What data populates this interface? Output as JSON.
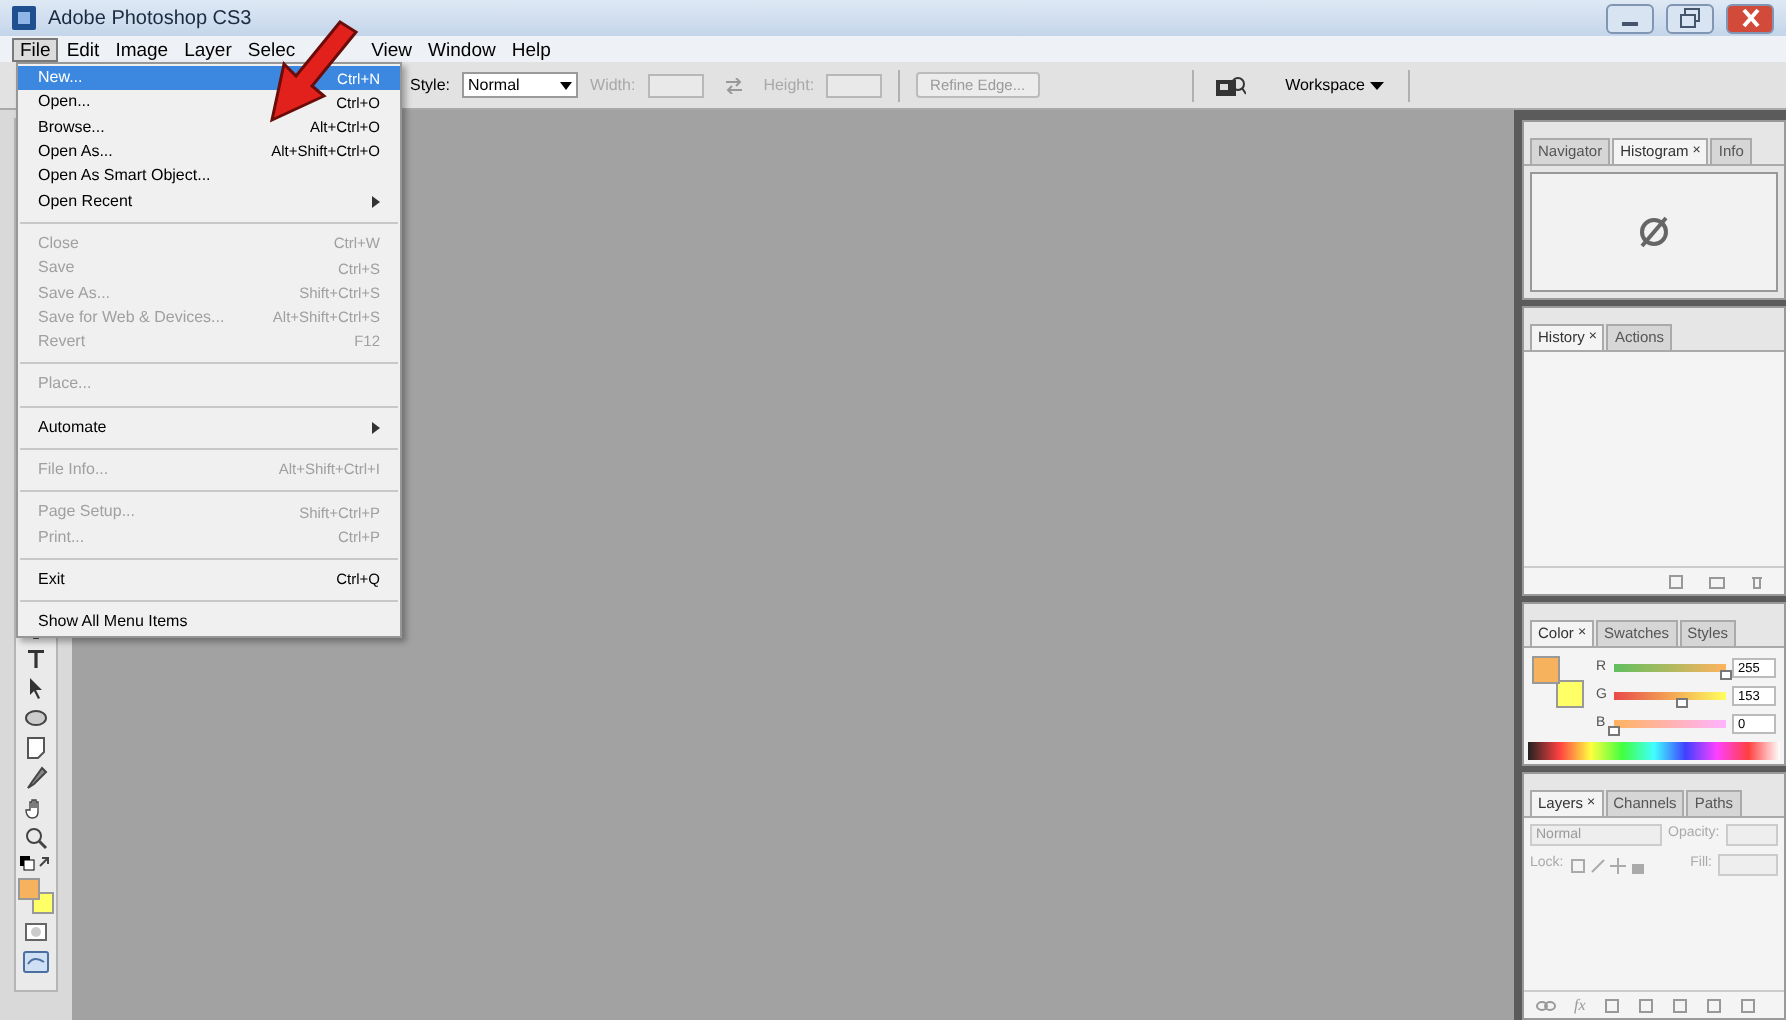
{
  "window": {
    "title": "Adobe Photoshop CS3"
  },
  "menu_bar": [
    {
      "label": "File",
      "selected": true
    },
    {
      "label": "Edit",
      "selected": false
    },
    {
      "label": "Image",
      "selected": false
    },
    {
      "label": "Layer",
      "selected": false
    },
    {
      "label": "Selec",
      "selected": false
    },
    {
      "label": "View",
      "selected": false
    },
    {
      "label": "Window",
      "selected": false
    },
    {
      "label": "Help",
      "selected": false
    }
  ],
  "file_menu": [
    {
      "kind": "item",
      "label": "New...",
      "shortcut": "Ctrl+N",
      "disabled": false,
      "selected": true
    },
    {
      "kind": "item",
      "label": "Open...",
      "shortcut": "Ctrl+O",
      "disabled": false,
      "selected": false
    },
    {
      "kind": "item",
      "label": "Browse...",
      "shortcut": "Alt+Ctrl+O",
      "disabled": false,
      "selected": false
    },
    {
      "kind": "item",
      "label": "Open As...",
      "shortcut": "Alt+Shift+Ctrl+O",
      "disabled": false,
      "selected": false
    },
    {
      "kind": "item",
      "label": "Open As Smart Object...",
      "disabled": false,
      "selected": false
    },
    {
      "kind": "submenu",
      "label": "Open Recent",
      "disabled": false,
      "selected": false
    },
    {
      "kind": "separator"
    },
    {
      "kind": "item",
      "label": "Close",
      "shortcut": "Ctrl+W",
      "disabled": true,
      "selected": false
    },
    {
      "kind": "item",
      "label": "Save",
      "shortcut": "Ctrl+S",
      "disabled": true,
      "selected": false
    },
    {
      "kind": "item",
      "label": "Save As...",
      "shortcut": "Shift+Ctrl+S",
      "disabled": true,
      "selected": false
    },
    {
      "kind": "item",
      "label": "Save for Web & Devices...",
      "shortcut": "Alt+Shift+Ctrl+S",
      "disabled": true,
      "selected": false
    },
    {
      "kind": "item",
      "label": "Revert",
      "shortcut": "F12",
      "disabled": true,
      "selected": false
    },
    {
      "kind": "separator"
    },
    {
      "kind": "item",
      "label": "Place...",
      "disabled": true,
      "selected": false
    },
    {
      "kind": "separator"
    },
    {
      "kind": "submenu",
      "label": "Automate",
      "disabled": false,
      "selected": false
    },
    {
      "kind": "separator"
    },
    {
      "kind": "item",
      "label": "File Info...",
      "shortcut": "Alt+Shift+Ctrl+I",
      "disabled": true,
      "selected": false
    },
    {
      "kind": "separator"
    },
    {
      "kind": "item",
      "label": "Page Setup...",
      "shortcut": "Shift+Ctrl+P",
      "disabled": true,
      "selected": false
    },
    {
      "kind": "item",
      "label": "Print...",
      "shortcut": "Ctrl+P",
      "disabled": true,
      "selected": false
    },
    {
      "kind": "separator"
    },
    {
      "kind": "item",
      "label": "Exit",
      "shortcut": "Ctrl+Q",
      "disabled": false,
      "selected": false
    },
    {
      "kind": "separator"
    },
    {
      "kind": "item",
      "label": "Show All Menu Items",
      "disabled": false,
      "selected": false
    }
  ],
  "options_bar": {
    "style_label": "Style:",
    "style_value": "Normal",
    "width": {
      "label": "Width:",
      "disabled": true
    },
    "height": {
      "label": "Height:",
      "disabled": true
    },
    "refine_edge": {
      "label": "Refine Edge...",
      "disabled": true
    },
    "workspace": "Workspace"
  },
  "panels": [
    {
      "kind": "navigator",
      "tabs": [
        {
          "label": "Navigator",
          "selected": false
        },
        {
          "label": "Histogram",
          "close": "×",
          "selected": true
        },
        {
          "label": "Info",
          "selected": false
        }
      ]
    },
    {
      "kind": "history",
      "tabs": [
        {
          "label": "History",
          "close": "×",
          "selected": true
        },
        {
          "label": "Actions",
          "selected": false
        }
      ]
    },
    {
      "kind": "color",
      "tabs": [
        {
          "label": "Color",
          "close": "×",
          "selected": true
        },
        {
          "label": "Swatches",
          "selected": false
        },
        {
          "label": "Styles",
          "selected": false
        }
      ],
      "swatches": [
        {
          "kind": "foreground",
          "color": "#f7b25e"
        },
        {
          "kind": "background",
          "color": "#ffff66"
        }
      ],
      "channels": [
        {
          "label": "R",
          "value": "255",
          "level": 1
        },
        {
          "label": "G",
          "value": "153",
          "level": 0.6
        },
        {
          "label": "B",
          "value": "0",
          "level": 0
        }
      ]
    },
    {
      "kind": "layers",
      "tabs": [
        {
          "label": "Layers",
          "close": "×",
          "selected": true
        },
        {
          "label": "Channels",
          "selected": false
        },
        {
          "label": "Paths",
          "selected": false
        }
      ],
      "blend_mode": "Normal",
      "opacity_label": "Opacity:",
      "lock_label": "Lock:",
      "fill_label": "Fill:",
      "fx_label": "fx"
    }
  ]
}
